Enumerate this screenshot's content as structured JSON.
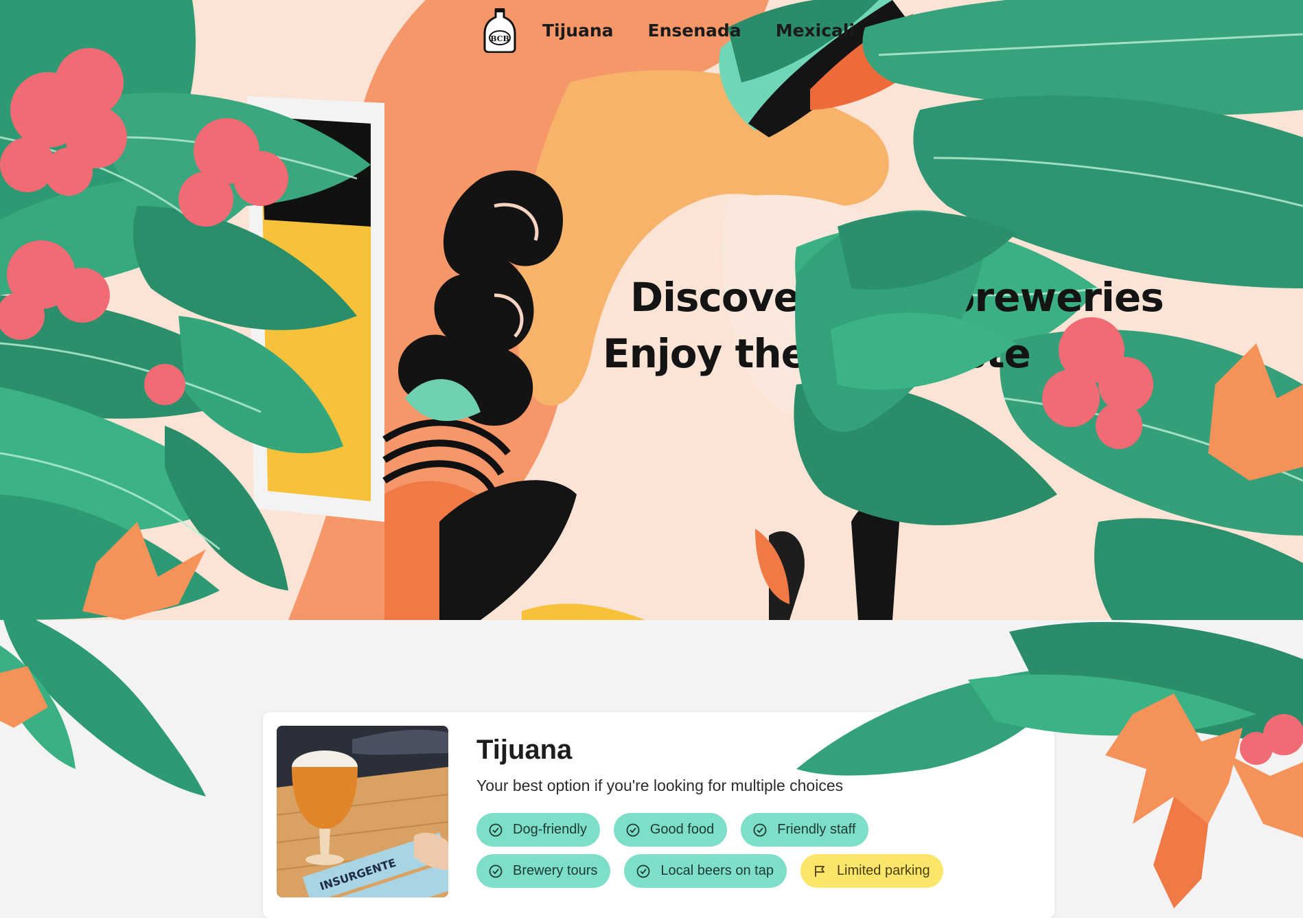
{
  "nav": {
    "logo_text": "BCB",
    "links": [
      "Tijuana",
      "Ensenada",
      "Mexicali"
    ]
  },
  "hero": {
    "line1": "Discover local breweries",
    "line2": "Enjoy the real taste"
  },
  "card": {
    "title": "Tijuana",
    "subtitle": "Your best option if you're looking for multiple choices",
    "image_brand_text": "INSURGENTE",
    "tags": [
      {
        "label": "Dog-friendly",
        "icon": "check-circle-icon",
        "type": "positive"
      },
      {
        "label": "Good food",
        "icon": "check-circle-icon",
        "type": "positive"
      },
      {
        "label": "Friendly staff",
        "icon": "check-circle-icon",
        "type": "positive"
      },
      {
        "label": "Brewery tours",
        "icon": "check-circle-icon",
        "type": "positive"
      },
      {
        "label": "Local beers on tap",
        "icon": "check-circle-icon",
        "type": "positive"
      },
      {
        "label": "Limited parking",
        "icon": "flag-icon",
        "type": "warning"
      }
    ]
  },
  "colors": {
    "tag_positive": "#7ddec9",
    "tag_warning": "#fbe66b",
    "leaf_green": "#2fa27a",
    "flower_pink": "#f06b74",
    "flower_orange": "#f5925a",
    "sun_orange": "#f7b26a"
  }
}
